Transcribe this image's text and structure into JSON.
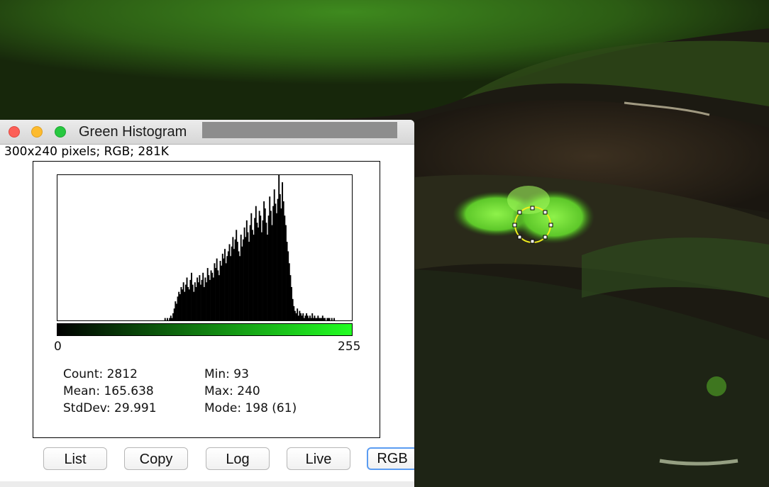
{
  "window": {
    "title": "Green Histogram",
    "image_info": "300x240 pixels; RGB; 281K"
  },
  "histogram": {
    "axis_min_label": "0",
    "axis_max_label": "255",
    "colors": {
      "ramp_start": "#000000",
      "ramp_end": "#22ff22",
      "bars": "#000000"
    }
  },
  "stats": {
    "count": "Count: 2812",
    "mean": "Mean: 165.638",
    "stddev": "StdDev: 29.991",
    "min": "Min: 93",
    "max": "Max: 240",
    "mode": "Mode: 198 (61)"
  },
  "buttons": {
    "list": "List",
    "copy": "Copy",
    "log": "Log",
    "live": "Live",
    "rgb": "RGB"
  },
  "chart_data": {
    "type": "bar",
    "title": "",
    "xlabel": "",
    "ylabel": "",
    "xlim": [
      0,
      255
    ],
    "ylim": [
      0,
      61
    ],
    "x": [
      93,
      94,
      95,
      96,
      97,
      98,
      99,
      100,
      101,
      102,
      103,
      104,
      105,
      106,
      107,
      108,
      109,
      110,
      111,
      112,
      113,
      114,
      115,
      116,
      117,
      118,
      119,
      120,
      121,
      122,
      123,
      124,
      125,
      126,
      127,
      128,
      129,
      130,
      131,
      132,
      133,
      134,
      135,
      136,
      137,
      138,
      139,
      140,
      141,
      142,
      143,
      144,
      145,
      146,
      147,
      148,
      149,
      150,
      151,
      152,
      153,
      154,
      155,
      156,
      157,
      158,
      159,
      160,
      161,
      162,
      163,
      164,
      165,
      166,
      167,
      168,
      169,
      170,
      171,
      172,
      173,
      174,
      175,
      176,
      177,
      178,
      179,
      180,
      181,
      182,
      183,
      184,
      185,
      186,
      187,
      188,
      189,
      190,
      191,
      192,
      193,
      194,
      195,
      196,
      197,
      198,
      199,
      200,
      201,
      202,
      203,
      204,
      205,
      206,
      207,
      208,
      209,
      210,
      211,
      212,
      213,
      214,
      215,
      216,
      217,
      218,
      219,
      220,
      221,
      222,
      223,
      224,
      225,
      226,
      227,
      228,
      229,
      230,
      231,
      232,
      233,
      234,
      235,
      236,
      237,
      238,
      239,
      240
    ],
    "values": [
      1,
      0,
      1,
      0,
      1,
      2,
      1,
      3,
      5,
      8,
      7,
      10,
      12,
      11,
      14,
      13,
      16,
      12,
      15,
      18,
      14,
      13,
      17,
      20,
      15,
      12,
      16,
      14,
      18,
      16,
      19,
      15,
      17,
      20,
      14,
      18,
      16,
      22,
      19,
      17,
      21,
      20,
      18,
      24,
      22,
      26,
      21,
      19,
      25,
      23,
      28,
      26,
      30,
      24,
      27,
      29,
      32,
      27,
      31,
      35,
      30,
      34,
      38,
      33,
      29,
      27,
      36,
      31,
      34,
      39,
      35,
      42,
      37,
      33,
      40,
      45,
      38,
      36,
      43,
      48,
      41,
      39,
      46,
      44,
      37,
      42,
      50,
      47,
      41,
      36,
      44,
      52,
      46,
      40,
      48,
      55,
      49,
      45,
      51,
      61,
      53,
      47,
      58,
      50,
      44,
      40,
      33,
      29,
      24,
      19,
      14,
      9,
      6,
      4,
      3,
      5,
      2,
      4,
      3,
      2,
      3,
      1,
      2,
      3,
      2,
      1,
      2,
      1,
      3,
      1,
      2,
      1,
      1,
      2,
      1,
      1,
      1,
      2,
      1,
      1,
      0,
      1,
      1,
      1,
      0,
      1,
      0,
      1
    ]
  }
}
